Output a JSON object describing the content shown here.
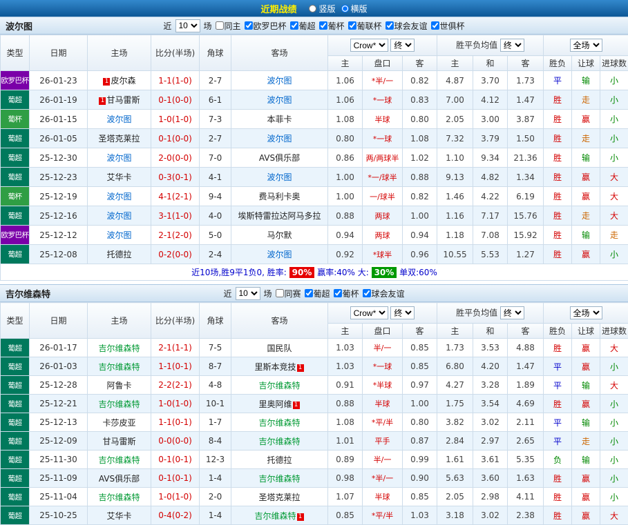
{
  "header": {
    "title": "近期战绩",
    "radio_vertical": "竖版",
    "radio_horizontal": "横版",
    "selected": "横版"
  },
  "colors": {
    "europa": "#7a00a8",
    "liga": "#00795c",
    "cup": "#2f9e44",
    "focal_0": "#0066cc",
    "focal_1": "#009933",
    "score": "#d40000",
    "line": "#d40000",
    "win": "#d40000",
    "draw": "#0000cc",
    "loss": "#008800",
    "push": "#cc6600",
    "rate_win_bg": "#e60000",
    "rate_big_bg": "#009900"
  },
  "columns": {
    "type": "类型",
    "date": "日期",
    "home": "主场",
    "score": "比分(半场)",
    "corner": "角球",
    "away": "客场",
    "odds_home": "主",
    "odds_line": "盘口",
    "odds_away": "客",
    "avg_home": "主",
    "avg_draw": "和",
    "avg_away": "客",
    "result": "胜负",
    "handicap": "让球",
    "goals": "进球数",
    "company": "Crow*",
    "final": "终",
    "avg_label": "胜平负均值",
    "fulltime": "全场"
  },
  "sections": [
    {
      "team": "波尔图",
      "filter": {
        "near": "近",
        "count": "10",
        "games": "场",
        "checkboxes": [
          {
            "label": "同主",
            "checked": false
          },
          {
            "label": "欧罗巴杯",
            "checked": true
          },
          {
            "label": "葡超",
            "checked": true
          },
          {
            "label": "葡杯",
            "checked": true
          },
          {
            "label": "葡联杯",
            "checked": true
          },
          {
            "label": "球会友谊",
            "checked": true
          },
          {
            "label": "世俱杯",
            "checked": true
          }
        ]
      },
      "rows": [
        {
          "league": "欧罗巴杯",
          "lkey": "europa",
          "date": "26-01-23",
          "home": "皮尔森",
          "hbadge": "1",
          "hbpos": "before",
          "hfocal": false,
          "score": "1-1(1-0)",
          "corner": "2-7",
          "away": "波尔图",
          "abadge": "",
          "abpos": "",
          "afocal": true,
          "o1": "1.06",
          "line": "*半/一",
          "o2": "0.82",
          "a1": "4.87",
          "a2": "3.70",
          "a3": "1.73",
          "r1": "平",
          "r2": "输",
          "r3": "小"
        },
        {
          "league": "葡超",
          "lkey": "liga",
          "date": "26-01-19",
          "home": "甘马雷斯",
          "hbadge": "1",
          "hbpos": "before",
          "hfocal": false,
          "score": "0-1(0-0)",
          "corner": "6-1",
          "away": "波尔图",
          "abadge": "",
          "abpos": "",
          "afocal": true,
          "o1": "1.06",
          "line": "*一球",
          "o2": "0.83",
          "a1": "7.00",
          "a2": "4.12",
          "a3": "1.47",
          "r1": "胜",
          "r2": "走",
          "r3": "小"
        },
        {
          "league": "葡杯",
          "lkey": "cup",
          "date": "26-01-15",
          "home": "波尔图",
          "hbadge": "",
          "hbpos": "",
          "hfocal": true,
          "score": "1-0(1-0)",
          "corner": "7-3",
          "away": "本菲卡",
          "abadge": "",
          "abpos": "",
          "afocal": false,
          "o1": "1.08",
          "line": "半球",
          "o2": "0.80",
          "a1": "2.05",
          "a2": "3.00",
          "a3": "3.87",
          "r1": "胜",
          "r2": "赢",
          "r3": "小"
        },
        {
          "league": "葡超",
          "lkey": "liga",
          "date": "26-01-05",
          "home": "圣塔克莱拉",
          "hbadge": "",
          "hbpos": "",
          "hfocal": false,
          "score": "0-1(0-0)",
          "corner": "2-7",
          "away": "波尔图",
          "abadge": "",
          "abpos": "",
          "afocal": true,
          "o1": "0.80",
          "line": "*一球",
          "o2": "1.08",
          "a1": "7.32",
          "a2": "3.79",
          "a3": "1.50",
          "r1": "胜",
          "r2": "走",
          "r3": "小"
        },
        {
          "league": "葡超",
          "lkey": "liga",
          "date": "25-12-30",
          "home": "波尔图",
          "hbadge": "",
          "hbpos": "",
          "hfocal": true,
          "score": "2-0(0-0)",
          "corner": "7-0",
          "away": "AVS俱乐部",
          "abadge": "",
          "abpos": "",
          "afocal": false,
          "o1": "0.86",
          "line": "两/两球半",
          "o2": "1.02",
          "a1": "1.10",
          "a2": "9.34",
          "a3": "21.36",
          "r1": "胜",
          "r2": "输",
          "r3": "小"
        },
        {
          "league": "葡超",
          "lkey": "liga",
          "date": "25-12-23",
          "home": "艾华卡",
          "hbadge": "",
          "hbpos": "",
          "hfocal": false,
          "score": "0-3(0-1)",
          "corner": "4-1",
          "away": "波尔图",
          "abadge": "",
          "abpos": "",
          "afocal": true,
          "o1": "1.00",
          "line": "*一/球半",
          "o2": "0.88",
          "a1": "9.13",
          "a2": "4.82",
          "a3": "1.34",
          "r1": "胜",
          "r2": "赢",
          "r3": "大"
        },
        {
          "league": "葡杯",
          "lkey": "cup",
          "date": "25-12-19",
          "home": "波尔图",
          "hbadge": "",
          "hbpos": "",
          "hfocal": true,
          "score": "4-1(2-1)",
          "corner": "9-4",
          "away": "费马利卡奥",
          "abadge": "",
          "abpos": "",
          "afocal": false,
          "o1": "1.00",
          "line": "一/球半",
          "o2": "0.82",
          "a1": "1.46",
          "a2": "4.22",
          "a3": "6.19",
          "r1": "胜",
          "r2": "赢",
          "r3": "大"
        },
        {
          "league": "葡超",
          "lkey": "liga",
          "date": "25-12-16",
          "home": "波尔图",
          "hbadge": "",
          "hbpos": "",
          "hfocal": true,
          "score": "3-1(1-0)",
          "corner": "4-0",
          "away": "埃斯特雷拉达阿马多拉",
          "abadge": "",
          "abpos": "",
          "afocal": false,
          "o1": "0.88",
          "line": "两球",
          "o2": "1.00",
          "a1": "1.16",
          "a2": "7.17",
          "a3": "15.76",
          "r1": "胜",
          "r2": "走",
          "r3": "大"
        },
        {
          "league": "欧罗巴杯",
          "lkey": "europa",
          "date": "25-12-12",
          "home": "波尔图",
          "hbadge": "",
          "hbpos": "",
          "hfocal": true,
          "score": "2-1(2-0)",
          "corner": "5-0",
          "away": "马尔默",
          "abadge": "",
          "abpos": "",
          "afocal": false,
          "o1": "0.94",
          "line": "两球",
          "o2": "0.94",
          "a1": "1.18",
          "a2": "7.08",
          "a3": "15.92",
          "r1": "胜",
          "r2": "输",
          "r3": "走"
        },
        {
          "league": "葡超",
          "lkey": "liga",
          "date": "25-12-08",
          "home": "托德拉",
          "hbadge": "",
          "hbpos": "",
          "hfocal": false,
          "score": "0-2(0-0)",
          "corner": "2-4",
          "away": "波尔图",
          "abadge": "",
          "abpos": "",
          "afocal": true,
          "o1": "0.92",
          "line": "*球半",
          "o2": "0.96",
          "a1": "10.55",
          "a2": "5.53",
          "a3": "1.27",
          "r1": "胜",
          "r2": "赢",
          "r3": "小"
        }
      ],
      "summary": {
        "prefix": "近10场,胜9平1负0, 胜率: ",
        "win_rate": "90%",
        "mid": " 赢率:40%  大: ",
        "big_rate": "30%",
        "suffix": " 单双:60%"
      }
    },
    {
      "team": "吉尔维森特",
      "filter": {
        "near": "近",
        "count": "10",
        "games": "场",
        "checkboxes": [
          {
            "label": "同赛",
            "checked": false
          },
          {
            "label": "葡超",
            "checked": true
          },
          {
            "label": "葡杯",
            "checked": true
          },
          {
            "label": "球会友谊",
            "checked": true
          }
        ]
      },
      "rows": [
        {
          "league": "葡超",
          "lkey": "liga",
          "date": "26-01-17",
          "home": "吉尔维森特",
          "hbadge": "",
          "hbpos": "",
          "hfocal": true,
          "score": "2-1(1-1)",
          "corner": "7-5",
          "away": "国民队",
          "abadge": "",
          "abpos": "",
          "afocal": false,
          "o1": "1.03",
          "line": "半/一",
          "o2": "0.85",
          "a1": "1.73",
          "a2": "3.53",
          "a3": "4.88",
          "r1": "胜",
          "r2": "赢",
          "r3": "大"
        },
        {
          "league": "葡超",
          "lkey": "liga",
          "date": "26-01-03",
          "home": "吉尔维森特",
          "hbadge": "",
          "hbpos": "",
          "hfocal": true,
          "score": "1-1(0-1)",
          "corner": "8-7",
          "away": "里斯本竞技",
          "abadge": "1",
          "abpos": "after",
          "afocal": false,
          "o1": "1.03",
          "line": "*一球",
          "o2": "0.85",
          "a1": "6.80",
          "a2": "4.20",
          "a3": "1.47",
          "r1": "平",
          "r2": "赢",
          "r3": "小"
        },
        {
          "league": "葡超",
          "lkey": "liga",
          "date": "25-12-28",
          "home": "阿鲁卡",
          "hbadge": "",
          "hbpos": "",
          "hfocal": false,
          "score": "2-2(2-1)",
          "corner": "4-8",
          "away": "吉尔维森特",
          "abadge": "",
          "abpos": "",
          "afocal": true,
          "o1": "0.91",
          "line": "*半球",
          "o2": "0.97",
          "a1": "4.27",
          "a2": "3.28",
          "a3": "1.89",
          "r1": "平",
          "r2": "输",
          "r3": "大"
        },
        {
          "league": "葡超",
          "lkey": "liga",
          "date": "25-12-21",
          "home": "吉尔维森特",
          "hbadge": "",
          "hbpos": "",
          "hfocal": true,
          "score": "1-0(1-0)",
          "corner": "10-1",
          "away": "里奥阿维",
          "abadge": "1",
          "abpos": "after",
          "afocal": false,
          "o1": "0.88",
          "line": "半球",
          "o2": "1.00",
          "a1": "1.75",
          "a2": "3.54",
          "a3": "4.69",
          "r1": "胜",
          "r2": "赢",
          "r3": "小"
        },
        {
          "league": "葡超",
          "lkey": "liga",
          "date": "25-12-13",
          "home": "卡莎皮亚",
          "hbadge": "",
          "hbpos": "",
          "hfocal": false,
          "score": "1-1(0-1)",
          "corner": "1-7",
          "away": "吉尔维森特",
          "abadge": "",
          "abpos": "",
          "afocal": true,
          "o1": "1.08",
          "line": "*平/半",
          "o2": "0.80",
          "a1": "3.82",
          "a2": "3.02",
          "a3": "2.11",
          "r1": "平",
          "r2": "输",
          "r3": "小"
        },
        {
          "league": "葡超",
          "lkey": "liga",
          "date": "25-12-09",
          "home": "甘马雷斯",
          "hbadge": "",
          "hbpos": "",
          "hfocal": false,
          "score": "0-0(0-0)",
          "corner": "8-4",
          "away": "吉尔维森特",
          "abadge": "",
          "abpos": "",
          "afocal": true,
          "o1": "1.01",
          "line": "平手",
          "o2": "0.87",
          "a1": "2.84",
          "a2": "2.97",
          "a3": "2.65",
          "r1": "平",
          "r2": "走",
          "r3": "小"
        },
        {
          "league": "葡超",
          "lkey": "liga",
          "date": "25-11-30",
          "home": "吉尔维森特",
          "hbadge": "",
          "hbpos": "",
          "hfocal": true,
          "score": "0-1(0-1)",
          "corner": "12-3",
          "away": "托德拉",
          "abadge": "",
          "abpos": "",
          "afocal": false,
          "o1": "0.89",
          "line": "半/一",
          "o2": "0.99",
          "a1": "1.61",
          "a2": "3.61",
          "a3": "5.35",
          "r1": "负",
          "r2": "输",
          "r3": "小"
        },
        {
          "league": "葡超",
          "lkey": "liga",
          "date": "25-11-09",
          "home": "AVS俱乐部",
          "hbadge": "",
          "hbpos": "",
          "hfocal": false,
          "score": "0-1(0-1)",
          "corner": "1-4",
          "away": "吉尔维森特",
          "abadge": "",
          "abpos": "",
          "afocal": true,
          "o1": "0.98",
          "line": "*半/一",
          "o2": "0.90",
          "a1": "5.63",
          "a2": "3.60",
          "a3": "1.63",
          "r1": "胜",
          "r2": "赢",
          "r3": "小"
        },
        {
          "league": "葡超",
          "lkey": "liga",
          "date": "25-11-04",
          "home": "吉尔维森特",
          "hbadge": "",
          "hbpos": "",
          "hfocal": true,
          "score": "1-0(1-0)",
          "corner": "2-0",
          "away": "圣塔克莱拉",
          "abadge": "",
          "abpos": "",
          "afocal": false,
          "o1": "1.07",
          "line": "半球",
          "o2": "0.85",
          "a1": "2.05",
          "a2": "2.98",
          "a3": "4.11",
          "r1": "胜",
          "r2": "赢",
          "r3": "小"
        },
        {
          "league": "葡超",
          "lkey": "liga",
          "date": "25-10-25",
          "home": "艾华卡",
          "hbadge": "",
          "hbpos": "",
          "hfocal": false,
          "score": "0-4(0-2)",
          "corner": "1-4",
          "away": "吉尔维森特",
          "abadge": "1",
          "abpos": "after",
          "afocal": true,
          "o1": "0.85",
          "line": "*平/半",
          "o2": "1.03",
          "a1": "3.18",
          "a2": "3.02",
          "a3": "2.38",
          "r1": "胜",
          "r2": "赢",
          "r3": "大"
        }
      ],
      "summary": null
    }
  ]
}
